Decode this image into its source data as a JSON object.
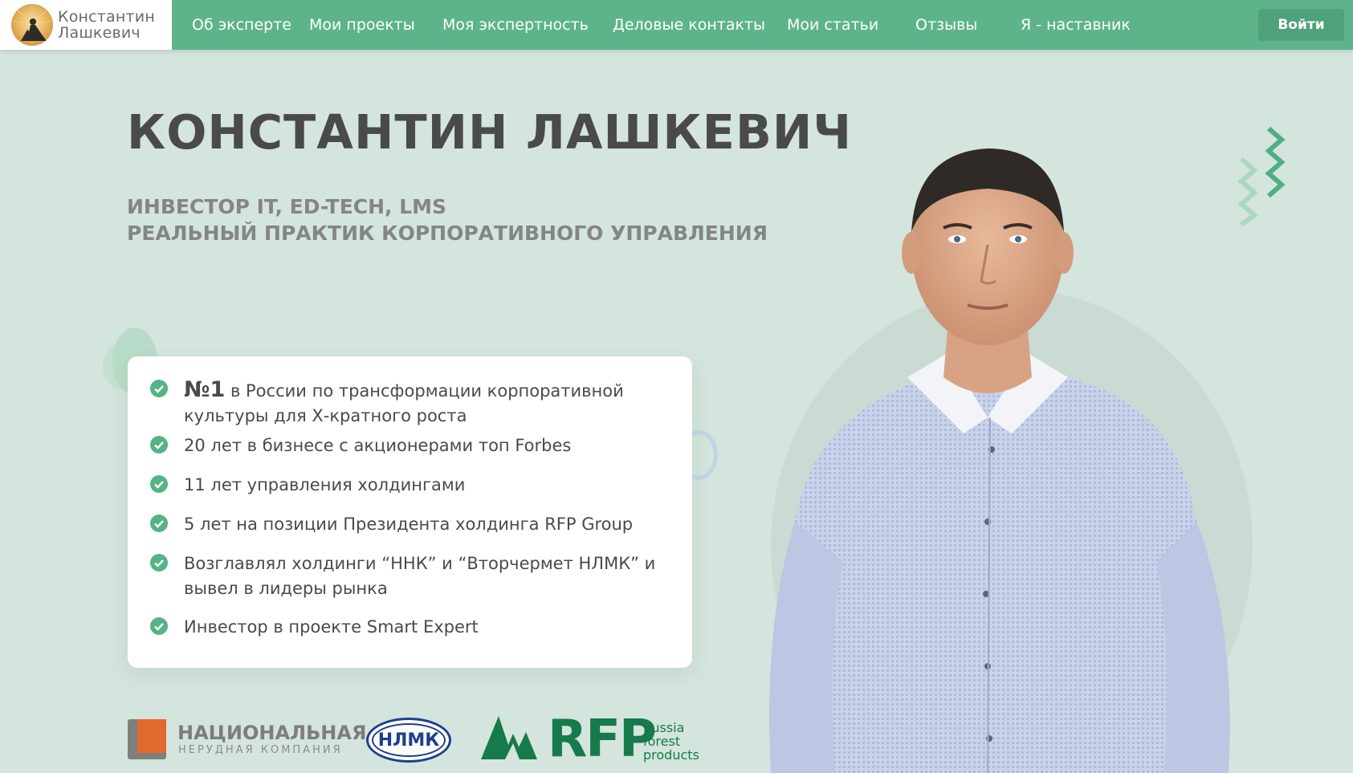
{
  "header": {
    "logo": {
      "line1": "Константин",
      "line2": "Лашкевич"
    },
    "nav": [
      {
        "label": "Об эксперте"
      },
      {
        "label": "Мои проекты"
      },
      {
        "label": "Моя экспертность"
      },
      {
        "label": "Деловые контакты"
      },
      {
        "label": "Мои статьи"
      },
      {
        "label": "Отзывы"
      },
      {
        "label": "Я - наставник"
      }
    ],
    "login_label": "Войти"
  },
  "hero": {
    "title": "КОНСТАНТИН ЛАШКЕВИЧ",
    "subtitle_1": "ИНВЕСТОР IT, ED-TECH, LMS",
    "subtitle_2": "РЕАЛЬНЫЙ ПРАКТИК КОРПОРАТИВНОГО УПРАВЛЕНИЯ"
  },
  "facts": {
    "first_highlight": "№1",
    "first_rest": "в России по трансформации корпоративной культуры для Х-кратного роста",
    "items": [
      "20 лет в бизнесе с акционерами топ Forbes",
      "11 лет управления холдингами",
      "5 лет на позиции Президента холдинга RFP Group",
      "Возглавлял холдинги “ННК” и “Вторчермет НЛМК” и вывел в лидеры рынка",
      "Инвестор в проекте Smart Expert"
    ]
  },
  "partners": {
    "nnk_title": "НАЦИОНАЛЬНАЯ",
    "nnk_sub": "НЕРУДНАЯ КОМПАНИЯ",
    "nlmk": "НЛМК",
    "rfp": "RFP",
    "rfp_sub": [
      "Russia",
      "forest",
      "products"
    ]
  },
  "colors": {
    "header": "#5db48b",
    "background": "#d3e5dc",
    "accent_check": "#55b385",
    "rfp_green": "#167a4a",
    "nlmk_blue": "#1e3f8f"
  },
  "icons": {
    "check": "check-circle-icon",
    "chevrons": "chevron-pattern-icon"
  }
}
